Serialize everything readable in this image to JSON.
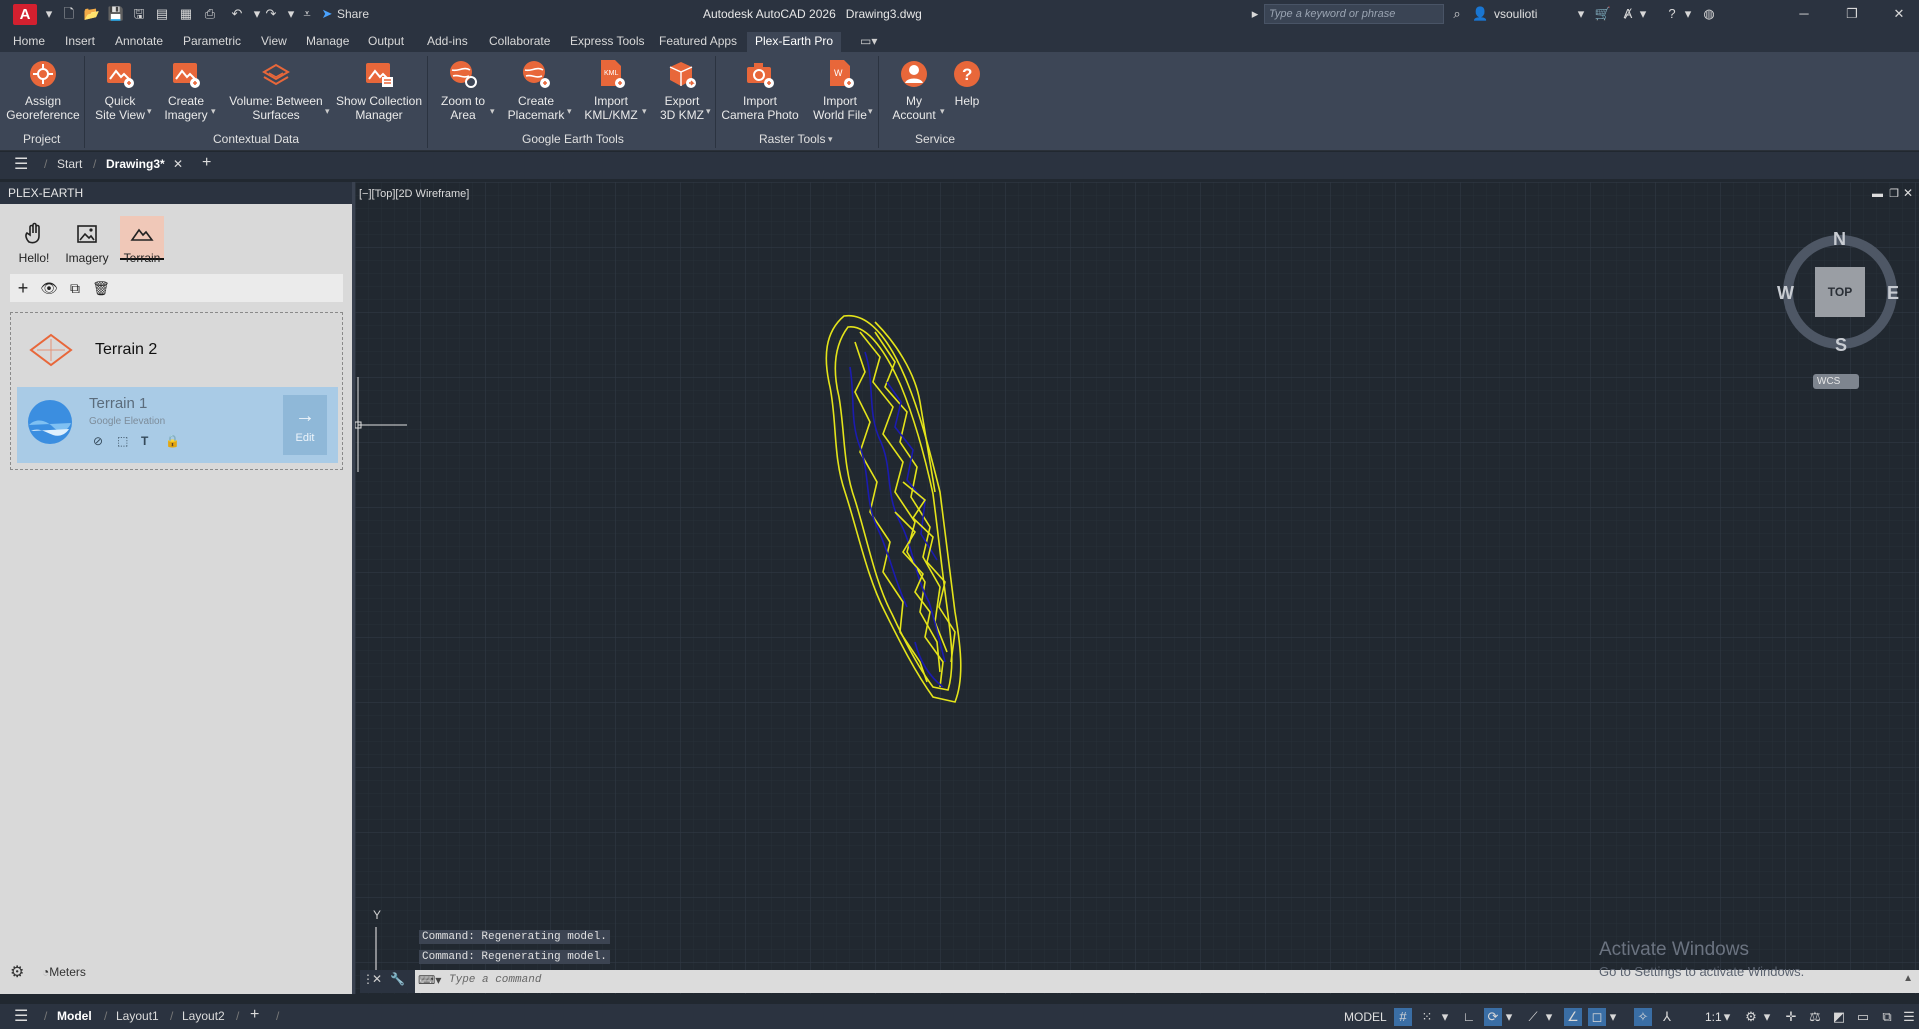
{
  "titlebar": {
    "app_icon": "A",
    "share_label": "Share",
    "app_title": "Autodesk AutoCAD 2026",
    "doc_title": "Drawing3.dwg",
    "search_placeholder": "Type a keyword or phrase",
    "username": "vsoulioti"
  },
  "ribbon_tabs": [
    "Home",
    "Insert",
    "Annotate",
    "Parametric",
    "View",
    "Manage",
    "Output",
    "Add-ins",
    "Collaborate",
    "Express Tools",
    "Featured Apps",
    "Plex-Earth Pro"
  ],
  "active_ribbon_tab": "Plex-Earth Pro",
  "ribbon": {
    "buttons": [
      {
        "l1": "Assign",
        "l2": "Georeference"
      },
      {
        "l1": "Quick",
        "l2": "Site View"
      },
      {
        "l1": "Create",
        "l2": "Imagery"
      },
      {
        "l1": "Volume: Between",
        "l2": "Surfaces"
      },
      {
        "l1": "Show Collection",
        "l2": "Manager"
      },
      {
        "l1": "Zoom to",
        "l2": "Area"
      },
      {
        "l1": "Create",
        "l2": "Placemark"
      },
      {
        "l1": "Import",
        "l2": "KML/KMZ"
      },
      {
        "l1": "Export",
        "l2": "3D KMZ"
      },
      {
        "l1": "Import",
        "l2": "Camera Photo"
      },
      {
        "l1": "Import",
        "l2": "World File"
      },
      {
        "l1": "My",
        "l2": "Account"
      },
      {
        "l1": "Help",
        "l2": ""
      }
    ],
    "panels": [
      "Project",
      "Contextual Data",
      "Google Earth Tools",
      "Raster Tools",
      "Service"
    ]
  },
  "file_tabs": {
    "start": "Start",
    "drawing": "Drawing3*"
  },
  "palette": {
    "title": "PLEX-EARTH",
    "tabs": [
      "Hello!",
      "Imagery",
      "Terrain"
    ],
    "active_tab": "Terrain",
    "terrain2": {
      "name": "Terrain 2"
    },
    "terrain1": {
      "name": "Terrain 1",
      "source": "Google Elevation",
      "edit_label": "Edit"
    },
    "units": "Meters"
  },
  "viewport": {
    "label": "[−][Top][2D Wireframe]",
    "viewcube": {
      "top": "TOP",
      "n": "N",
      "s": "S",
      "e": "E",
      "w": "W",
      "wcs": "WCS"
    },
    "ucs_y": "Y",
    "contour_colors": {
      "major": "#e4e41a",
      "minor": "#1b1bb0"
    }
  },
  "command": {
    "history": [
      "Command: Regenerating model.",
      "Command: Regenerating model."
    ],
    "placeholder": "Type a command"
  },
  "statusbar": {
    "tabs": [
      "Model",
      "Layout1",
      "Layout2"
    ],
    "model_label": "MODEL",
    "scale": "1:1"
  },
  "watermark": {
    "line1": "Activate Windows",
    "line2": "Go to Settings to activate Windows."
  },
  "colors": {
    "accent": "#e8673a",
    "terrain_selected_bg": "#a9cbe6",
    "palette_bg": "#d9d9d9"
  }
}
